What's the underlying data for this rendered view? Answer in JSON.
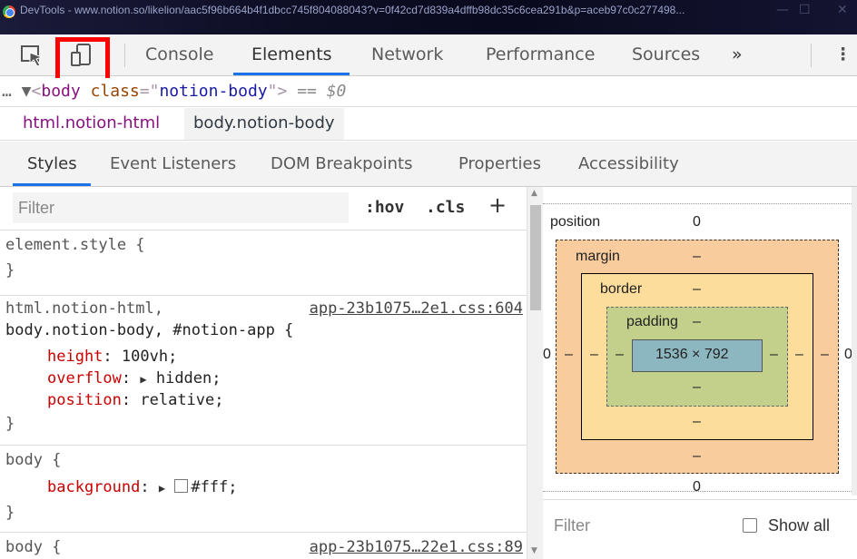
{
  "window": {
    "title": "DevTools - www.notion.so/likelion/aac5f96b664b4f1dbcc745f8040880​43?v=0f42cd7d839a4dffb98dc35c6cea291b&p=aceb97c0c277498...",
    "minimize": "—",
    "maximize": "☐",
    "close": "✕"
  },
  "toolbar": {
    "tabs": [
      "Console",
      "Elements",
      "Network",
      "Performance",
      "Sources"
    ],
    "active_tab": "Elements",
    "more": "»",
    "menu": "⋮"
  },
  "dom_path": {
    "prefix": "… ▼",
    "tag_open": "<",
    "tag": "body",
    "attr_name": "class",
    "attr_eq": "=\"",
    "attr_value": "notion-body",
    "tag_close": "\">",
    "selected_marker": "== $0"
  },
  "breadcrumbs": [
    "html.notion-html",
    "body.notion-body"
  ],
  "subtabs": [
    "Styles",
    "Event Listeners",
    "DOM Breakpoints",
    "Properties",
    "Accessibility"
  ],
  "styles": {
    "filter_placeholder": "Filter",
    "hov": ":hov",
    "cls": ".cls",
    "plus": "+",
    "element_style": "element.style {",
    "close_brace": "}",
    "rule1_sel1": "html.notion-html,",
    "rule1_src": "app-23b1075…2e1.css:604",
    "rule1_sel2": "body.notion-body, #notion-app {",
    "rule1_props": [
      {
        "name": "height",
        "value": " 100vh;"
      },
      {
        "name": "overflow",
        "value": " hidden;"
      },
      {
        "name": "position",
        "value": " relative;"
      }
    ],
    "rule2_sel": "body {",
    "rule2_prop": "background",
    "rule2_value": "#fff;",
    "rule3_sel": "body {",
    "rule3_src": "app-23b1075…22e1.css:89"
  },
  "box_model": {
    "position_label": "position",
    "position_value": "0",
    "margin_label": "margin",
    "border_label": "border",
    "padding_label": "padding",
    "dash": "–",
    "content": "1536 × 792",
    "left_value": "0",
    "right_value": "0",
    "bottom_value": "0",
    "filter_placeholder": "Filter",
    "show_all": "Show all"
  }
}
